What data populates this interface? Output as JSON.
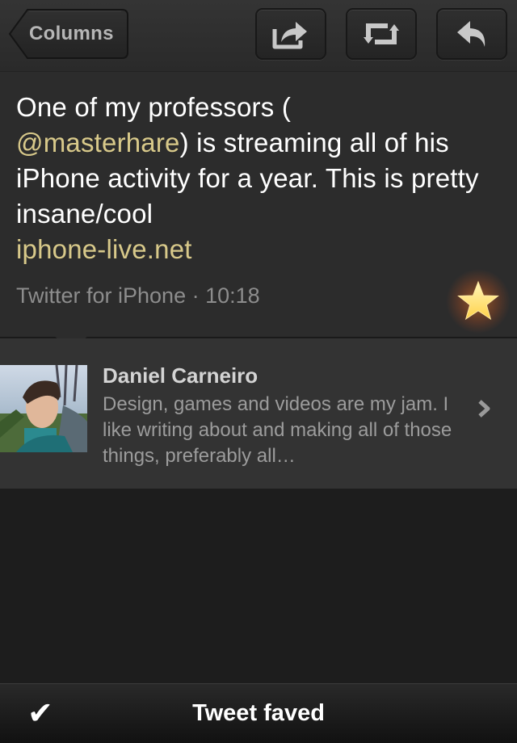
{
  "toolbar": {
    "back_label": "Columns",
    "share_icon": "share-icon",
    "retweet_icon": "retweet-icon",
    "reply_icon": "reply-icon"
  },
  "tweet": {
    "text_before": "One of my professors (",
    "mention": "@masterhare",
    "text_after": ") is streaming all of his iPhone activity for a year. This is pretty insane/cool",
    "link": "iphone-live.net",
    "meta": "Twitter for iPhone · 10:18",
    "favorited": true
  },
  "profile": {
    "name": "Daniel Carneiro",
    "bio": "Design, games and videos are my jam. I like writing about and making all of those things, preferably all…"
  },
  "status": {
    "icon": "checkmark",
    "text": "Tweet faved"
  },
  "colors": {
    "accent_link": "#d8c98a",
    "star": "#ffe680"
  }
}
